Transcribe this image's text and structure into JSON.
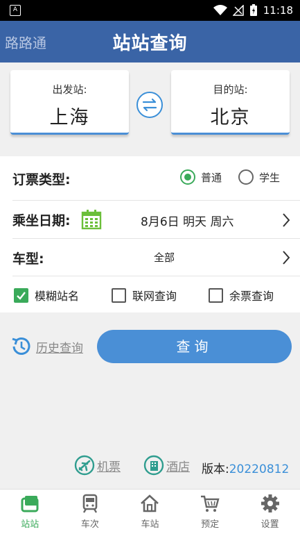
{
  "status_bar": {
    "time": "11:18",
    "notification_icon": "A"
  },
  "header": {
    "app_name": "路路通",
    "title": "站站查询"
  },
  "stations": {
    "from_label": "出发站:",
    "from_name": "上海",
    "to_label": "目的站:",
    "to_name": "北京"
  },
  "ticket_type": {
    "label": "订票类型:",
    "options": [
      {
        "label": "普通",
        "selected": true
      },
      {
        "label": "学生",
        "selected": false
      }
    ]
  },
  "date": {
    "label": "乘坐日期:",
    "value": "8月6日 明天 周六"
  },
  "train_type": {
    "label": "车型:",
    "value": "全部"
  },
  "options": [
    {
      "label": "模糊站名",
      "checked": true
    },
    {
      "label": "联网查询",
      "checked": false
    },
    {
      "label": "余票查询",
      "checked": false
    }
  ],
  "history_label": "历史查询",
  "search_label": "查询",
  "links": {
    "flight": "机票",
    "hotel": "酒店",
    "version_label": "版本:",
    "version_value": "20220812"
  },
  "tabs": [
    {
      "label": "站站",
      "icon": "station-to-station-icon",
      "active": true
    },
    {
      "label": "车次",
      "icon": "train-icon",
      "active": false
    },
    {
      "label": "车站",
      "icon": "home-icon",
      "active": false
    },
    {
      "label": "预定",
      "icon": "cart-icon",
      "active": false
    },
    {
      "label": "设置",
      "icon": "gear-icon",
      "active": false
    }
  ],
  "colors": {
    "header_blue": "#3a64a6",
    "accent_blue": "#4a8fd6",
    "accent_green": "#3aaa5a"
  }
}
